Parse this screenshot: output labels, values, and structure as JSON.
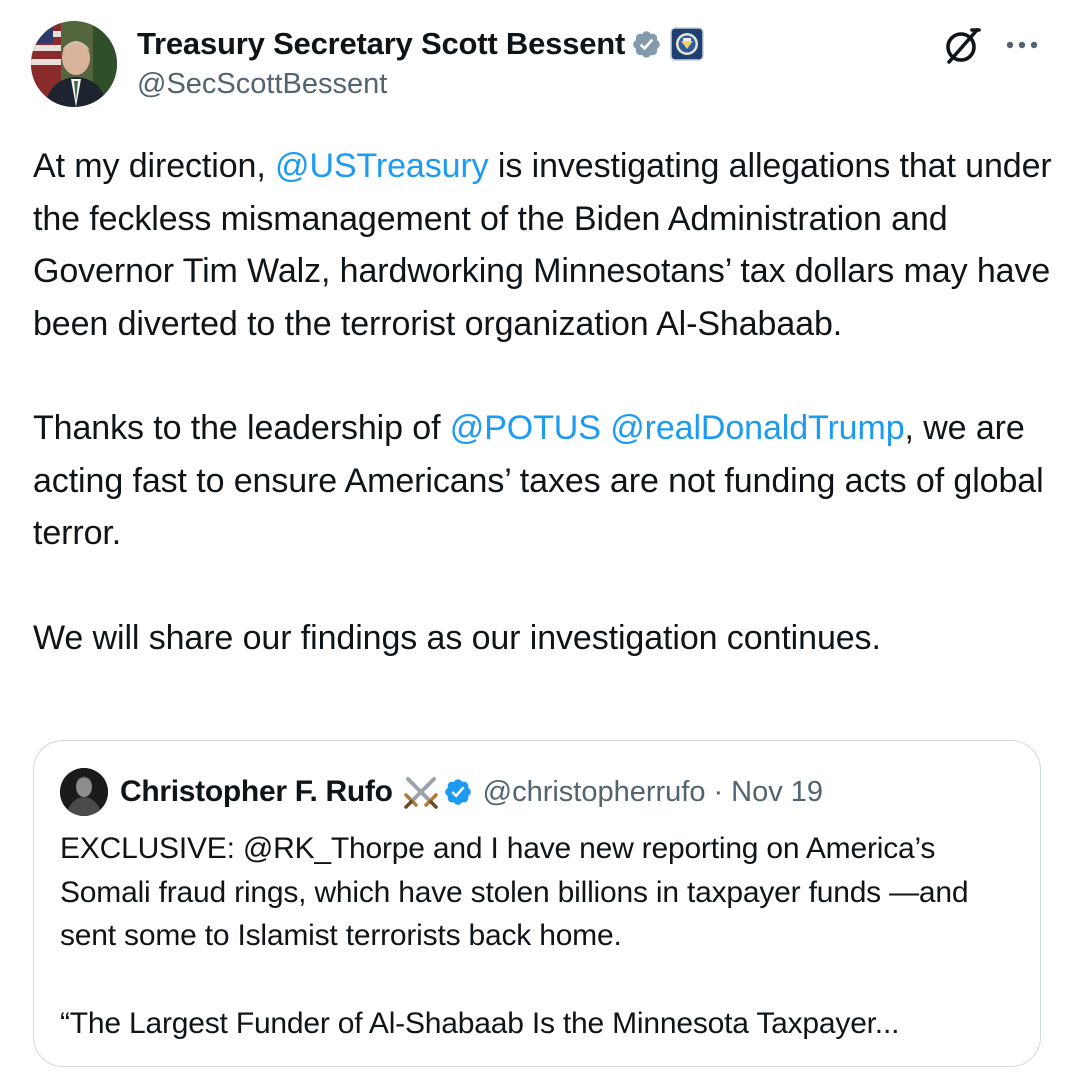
{
  "author": {
    "display_name": "Treasury Secretary Scott Bessent",
    "handle": "@SecScottBessent",
    "verified": true,
    "badge_color": "#829aab",
    "affiliation_icon": "treasury-seal-icon"
  },
  "body": {
    "para1": {
      "before": "At my direction, ",
      "mention": "@USTreasury",
      "after": " is investigating allegations that under the feckless mismanagement of the Biden Administration and Governor Tim Walz, hardworking Minnesotans’ tax dollars may have been diverted to the terrorist organization Al-Shabaab."
    },
    "para2": {
      "before": "Thanks to the leadership of ",
      "mention1": "@POTUS",
      "between": " ",
      "mention2": "@realDonaldTrump",
      "after": ", we are acting fast to ensure Americans’ taxes are not funding acts of global terror."
    },
    "para3": "We will share our findings as our investigation continues."
  },
  "quoted_post": {
    "display_name": "Christopher F. Rufo",
    "emoji": "crossed-swords-icon",
    "verified": true,
    "badge_color": "#1d9bf0",
    "handle": "@christopherrufo",
    "separator": "·",
    "date": "Nov 19",
    "text1": "EXCLUSIVE: @RK_Thorpe and I have new reporting on America’s Somali fraud rings, which have stolen billions in taxpayer funds —and sent some to Islamist terrorists back home.",
    "text2": "“The Largest Funder of Al-Shabaab Is the Minnesota Taxpayer..."
  },
  "colors": {
    "text": "#0f1419",
    "secondary": "#536471",
    "link": "#1d9bf0",
    "border": "#cfd9de"
  }
}
